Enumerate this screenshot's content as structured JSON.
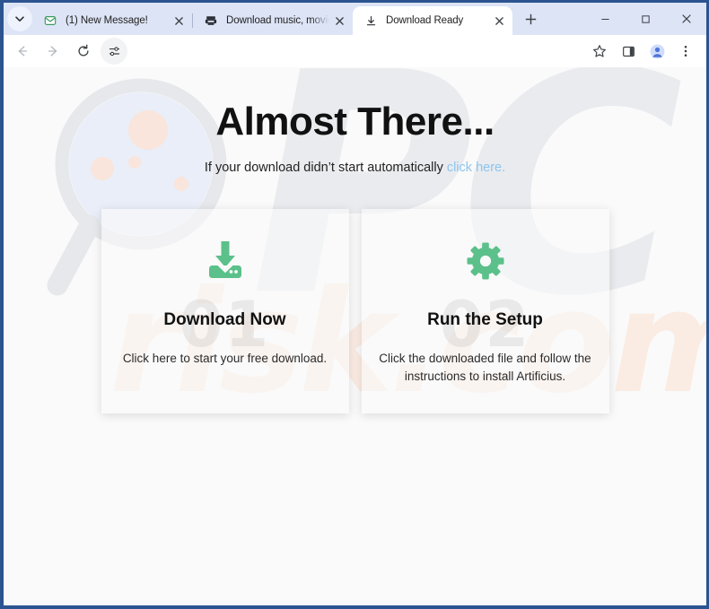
{
  "browser": {
    "tabstrip": {
      "tab_search_icon": "chevron-down-icon",
      "new_tab_label": "+",
      "tabs": [
        {
          "title": "(1) New Message!",
          "favicon": "mail-icon",
          "active": false,
          "close_label": "×"
        },
        {
          "title": "Download music, movies, games",
          "favicon": "torrent-icon",
          "active": false,
          "close_label": "×"
        },
        {
          "title": "Download Ready",
          "favicon": "download-icon",
          "active": true,
          "close_label": "×"
        }
      ]
    },
    "window_controls": {
      "minimize": "–",
      "maximize": "□",
      "close": "✕"
    },
    "toolbar": {
      "back_icon": "back-arrow-icon",
      "forward_icon": "forward-arrow-icon",
      "reload_icon": "reload-icon",
      "tune_icon": "sliders-icon",
      "bookmark_icon": "star-icon",
      "sidepanel_icon": "side-panel-icon",
      "profile_icon": "profile-avatar-icon",
      "menu_icon": "three-dot-menu-icon"
    }
  },
  "page": {
    "headline": "Almost There...",
    "subtitle_text": "If your download didn’t start automatically ",
    "subtitle_link": "click here.",
    "watermark": {
      "brand_top": "PC",
      "brand_bottom": "risk.com",
      "magnifier_icon": "magnifying-glass-icon"
    },
    "cards": [
      {
        "badge": "01",
        "icon": "download-tray-icon",
        "title": "Download Now",
        "description": "Click here to start your free download."
      },
      {
        "badge": "02",
        "icon": "gear-icon",
        "title": "Run the Setup",
        "description": "Click the downloaded file and follow the instructions to install Artificius."
      }
    ]
  },
  "colors": {
    "accent_green": "#5cc08a",
    "link_blue": "#8dc4ef",
    "window_border": "#2b5490",
    "tabstrip_bg": "#dde4f6",
    "watermark_peach": "#fbece3"
  }
}
